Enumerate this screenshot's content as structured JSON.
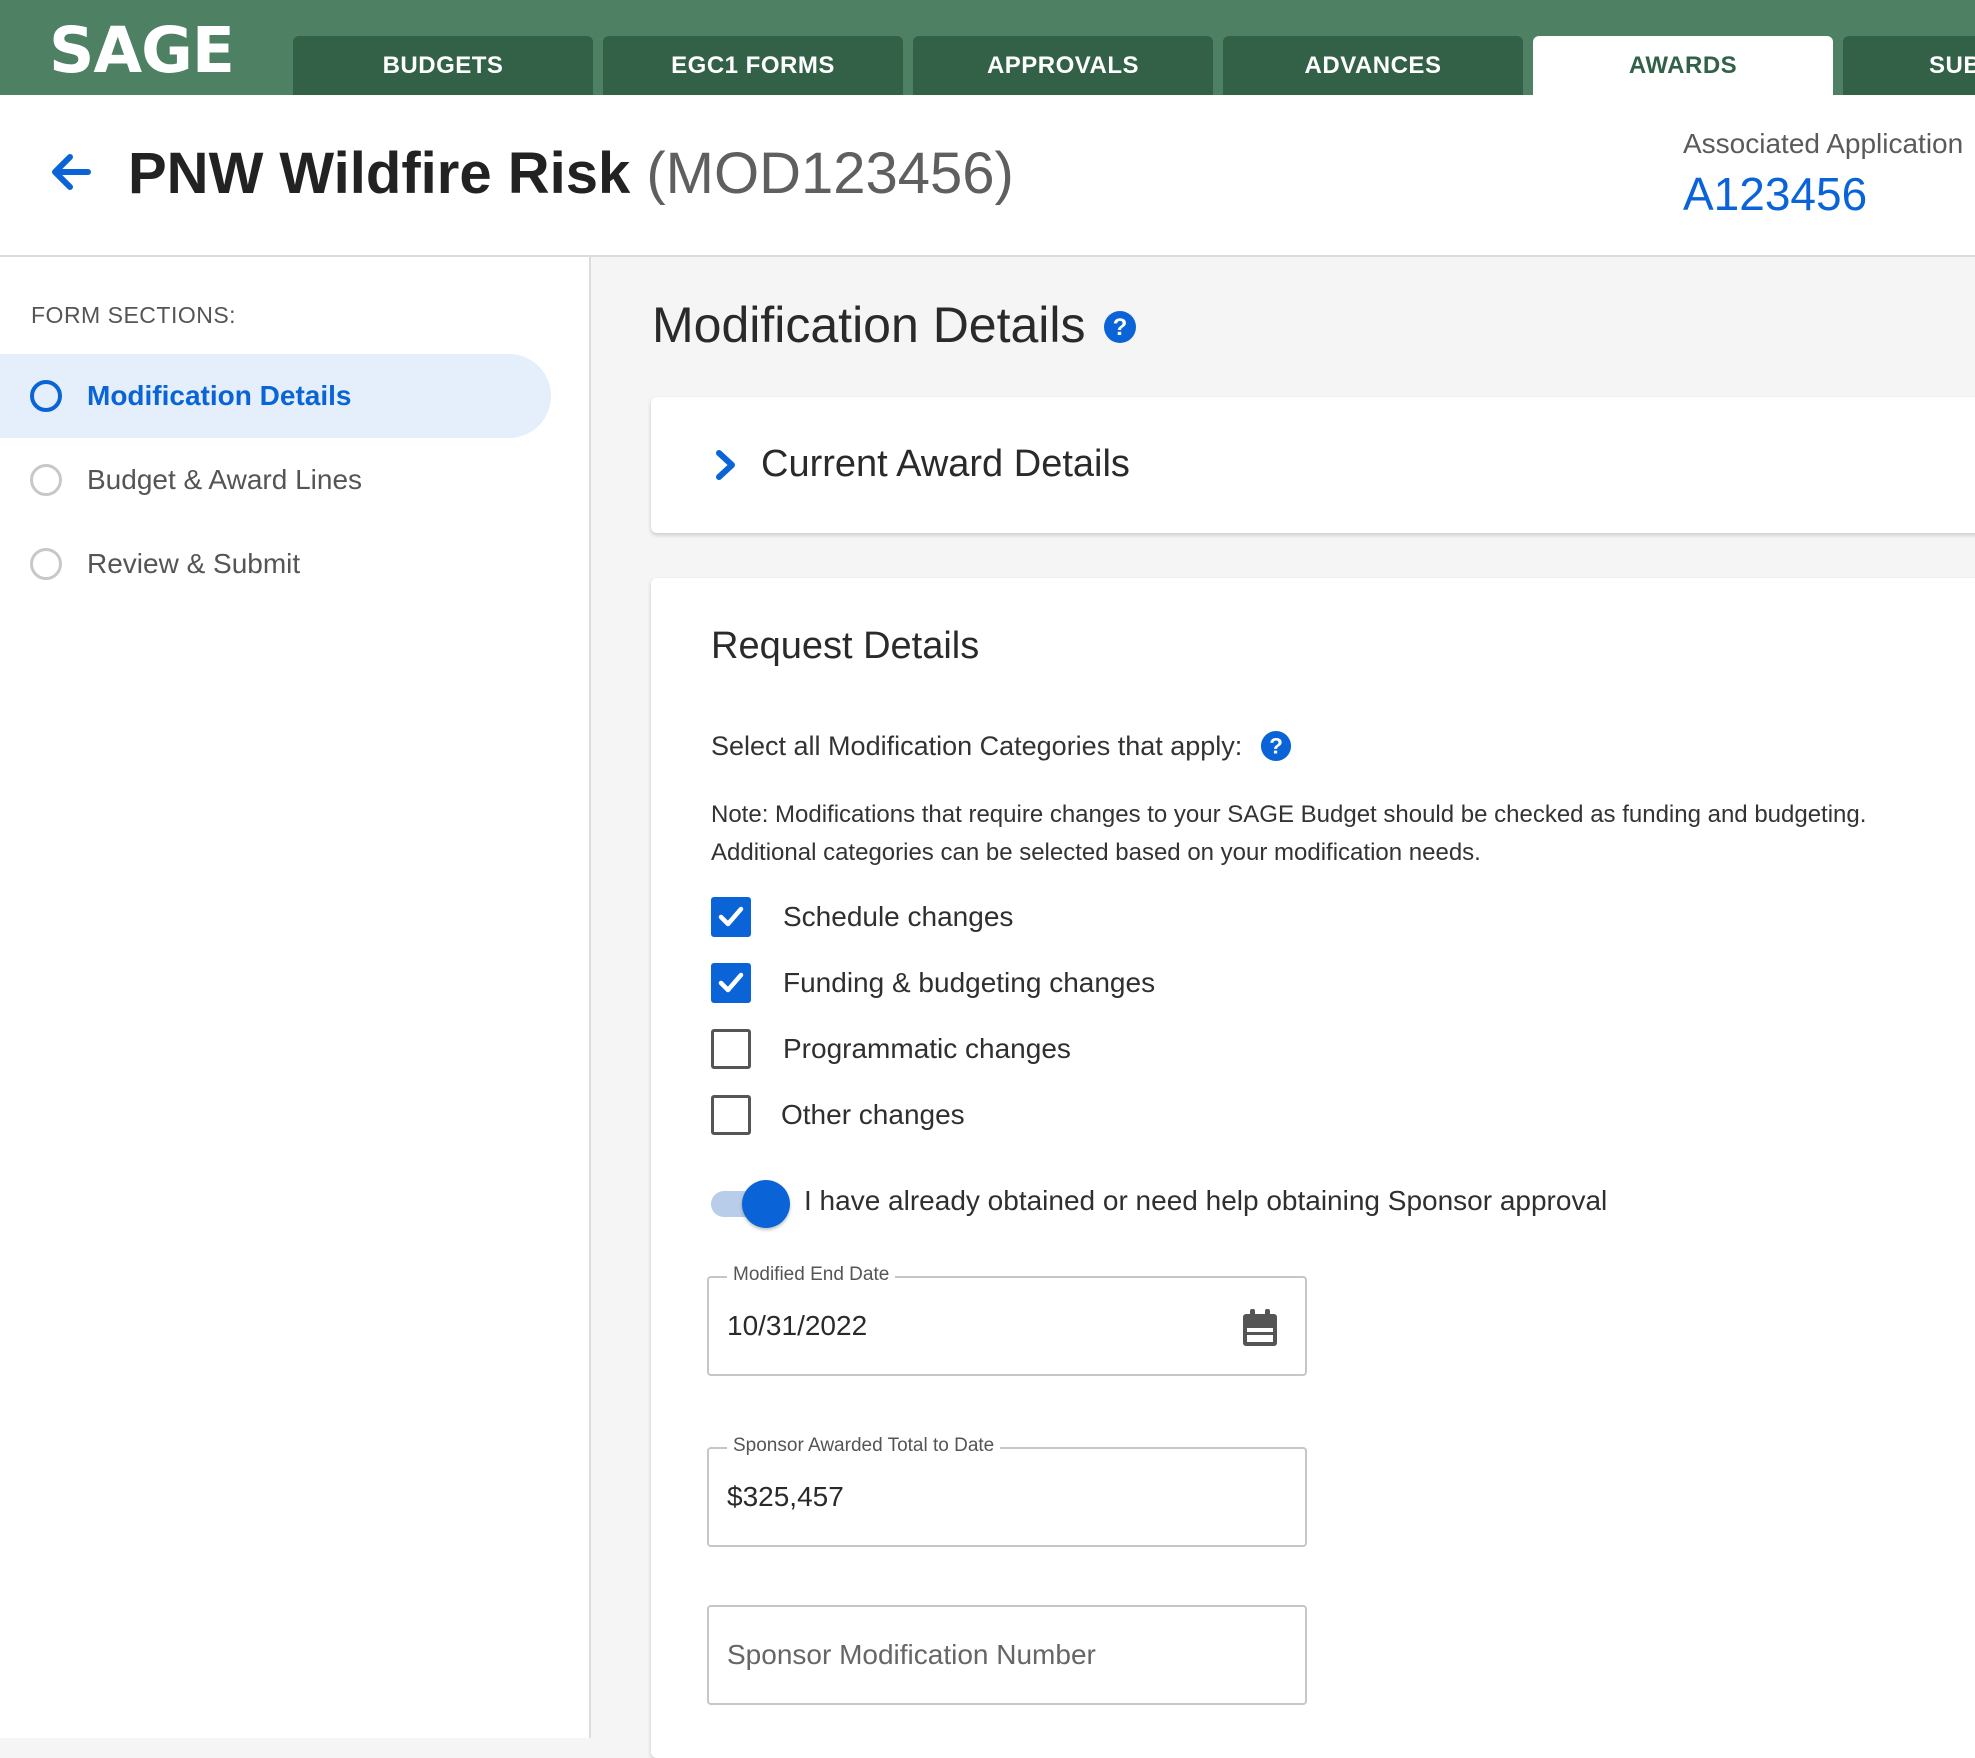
{
  "app": {
    "logo": "SAGE"
  },
  "colors": {
    "brand_green": "#4e8064",
    "tab_dark": "#336148",
    "accent_blue": "#0a64d8"
  },
  "nav": {
    "tabs": [
      {
        "label": "BUDGETS",
        "active": false
      },
      {
        "label": "EGC1 FORMS",
        "active": false
      },
      {
        "label": "APPROVALS",
        "active": false
      },
      {
        "label": "ADVANCES",
        "active": false
      },
      {
        "label": "AWARDS",
        "active": true
      },
      {
        "label": "SUB",
        "active": false
      }
    ]
  },
  "header": {
    "back_icon": "arrow-left-icon",
    "title_name": "PNW Wildfire Risk",
    "title_code": "(MOD123456)",
    "assoc_label": "Associated Application",
    "assoc_link": "A123456"
  },
  "sidebar": {
    "heading": "FORM SECTIONS:",
    "items": [
      {
        "label": "Modification Details",
        "active": true
      },
      {
        "label": "Budget & Award Lines",
        "active": false
      },
      {
        "label": "Review & Submit",
        "active": false
      }
    ]
  },
  "main": {
    "section_title": "Modification Details",
    "current_award": {
      "title": "Current Award Details",
      "icon": "chevron-right-icon"
    },
    "request": {
      "title": "Request Details",
      "select_label": "Select all Modification Categories that apply:",
      "note_line1": "Note: Modifications that require changes to your SAGE Budget should be checked as funding and budgeting.",
      "note_line2": "Additional categories can be selected based on your modification needs.",
      "categories": [
        {
          "label": "Schedule changes",
          "checked": true
        },
        {
          "label": "Funding & budgeting changes",
          "checked": true
        },
        {
          "label": "Programmatic changes",
          "checked": false
        },
        {
          "label": "Other changes",
          "checked": false
        }
      ],
      "toggle": {
        "label": "I have already obtained or need help obtaining Sponsor approval",
        "on": true
      },
      "end_date": {
        "label": "Modified End Date",
        "value": "10/31/2022",
        "icon": "calendar-icon"
      },
      "awarded_total": {
        "label": "Sponsor Awarded Total to Date",
        "value": "$325,457"
      },
      "mod_number": {
        "placeholder": "Sponsor Modification Number",
        "value": ""
      }
    }
  }
}
